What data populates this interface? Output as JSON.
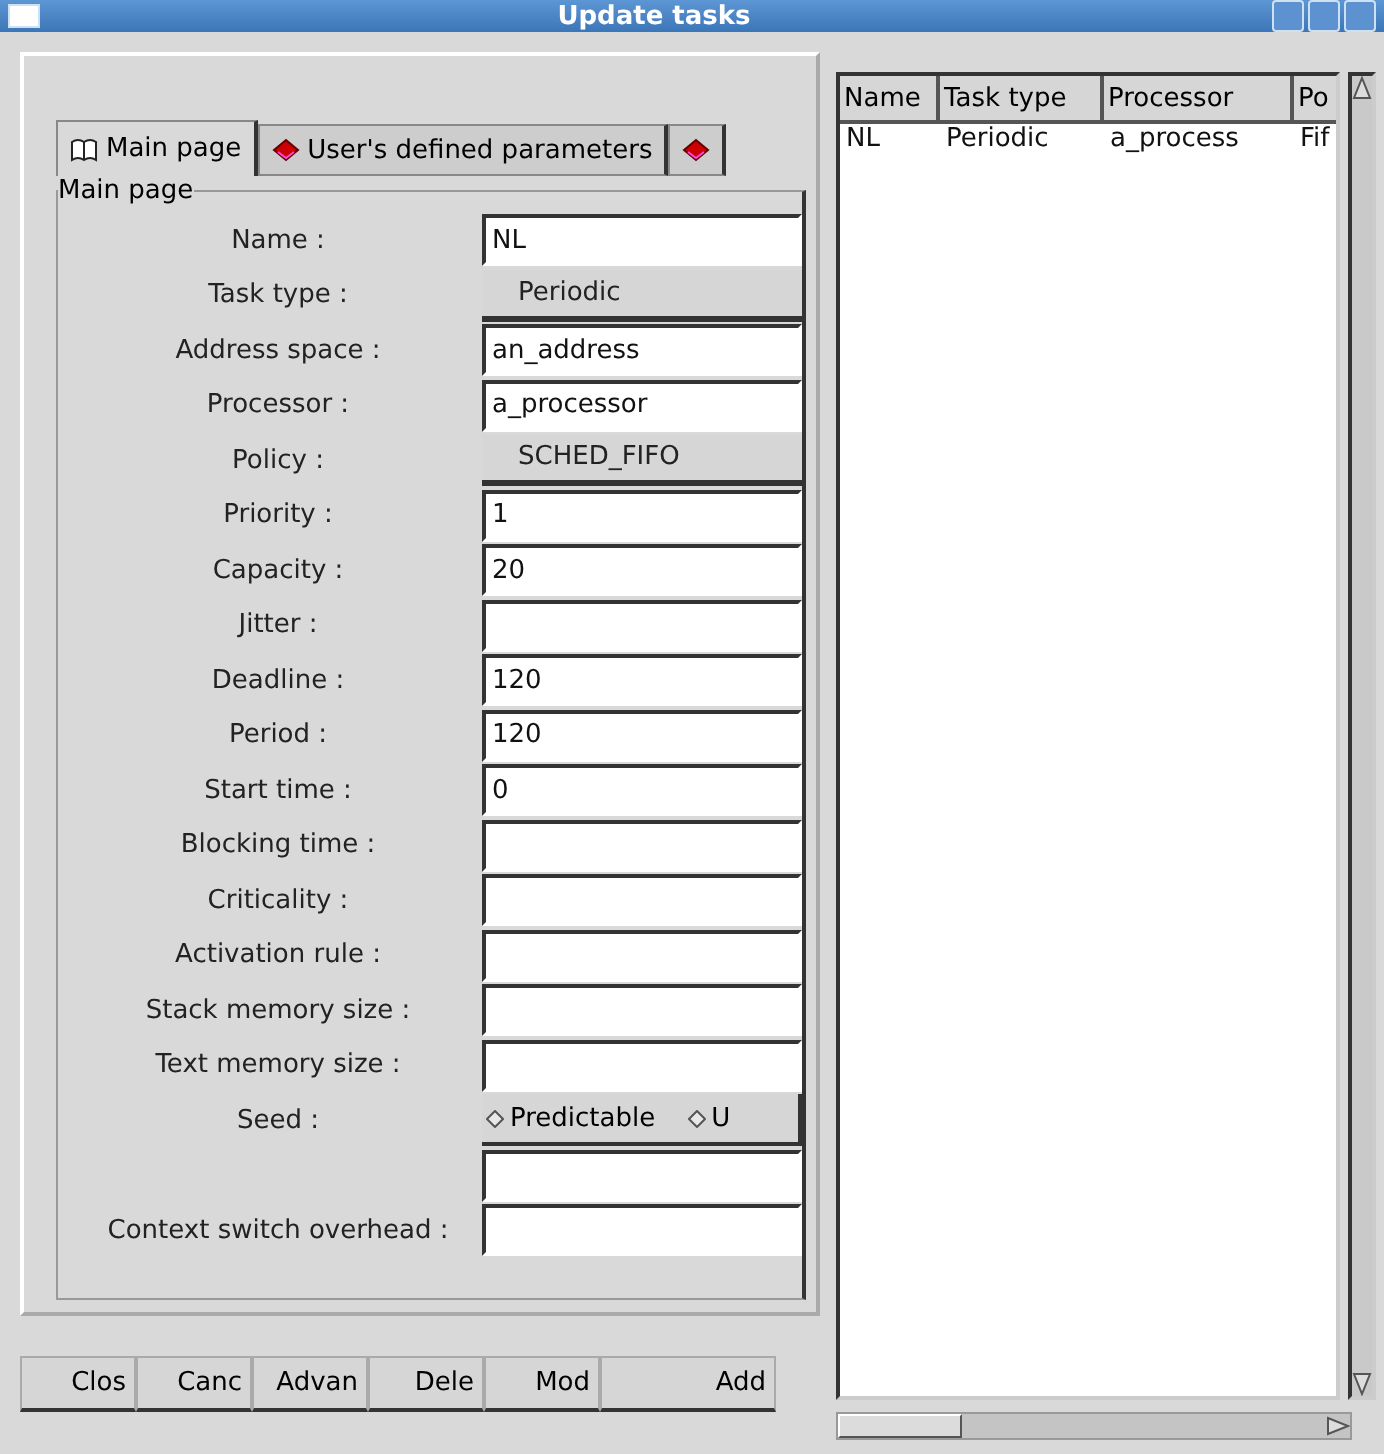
{
  "window": {
    "title": "Update tasks"
  },
  "tabs": [
    {
      "label": "Main page",
      "selected": true
    },
    {
      "label": "User's defined parameters",
      "selected": false
    },
    {
      "selected": false
    }
  ],
  "group": {
    "title": "Main page"
  },
  "fields": [
    {
      "kind": "text",
      "label": "Name :",
      "value": "NL"
    },
    {
      "kind": "option",
      "label": "Task type :",
      "value": "Periodic"
    },
    {
      "kind": "text",
      "label": "Address space :",
      "value": "an_address"
    },
    {
      "kind": "text",
      "label": "Processor  :",
      "value": "a_processor"
    },
    {
      "kind": "option",
      "label": "Policy :",
      "value": "SCHED_FIFO"
    },
    {
      "kind": "text",
      "label": "Priority :",
      "value": "1"
    },
    {
      "kind": "text",
      "label": "Capacity :",
      "value": "20"
    },
    {
      "kind": "text",
      "label": "Jitter :"
    },
    {
      "kind": "text",
      "label": "Deadline :",
      "value": "120"
    },
    {
      "kind": "text",
      "label": "Period :",
      "value": "120"
    },
    {
      "kind": "text",
      "label": "Start time :",
      "value": "0"
    },
    {
      "kind": "text",
      "label": "Blocking time  :"
    },
    {
      "kind": "text",
      "label": "Criticality :"
    },
    {
      "kind": "text",
      "label": "Activation rule :"
    },
    {
      "kind": "text",
      "label": "Stack memory size :"
    },
    {
      "kind": "text",
      "label": "Text memory size :"
    },
    {
      "kind": "radio",
      "label": "Seed :",
      "options": [
        {
          "label": "Predictable",
          "selected": false
        },
        {
          "label": "U",
          "selected": false
        }
      ]
    },
    {
      "kind": "text"
    },
    {
      "kind": "text",
      "label": "Context switch overhead :"
    }
  ],
  "buttons": [
    "Clos",
    "Canc",
    "Advan",
    "Dele",
    "Mod",
    "Add"
  ],
  "table": {
    "columns": [
      "Name",
      "Task type",
      "Processor",
      "Po"
    ],
    "rows": [
      [
        "NL",
        "Periodic",
        "a_process",
        "Fif"
      ]
    ]
  }
}
